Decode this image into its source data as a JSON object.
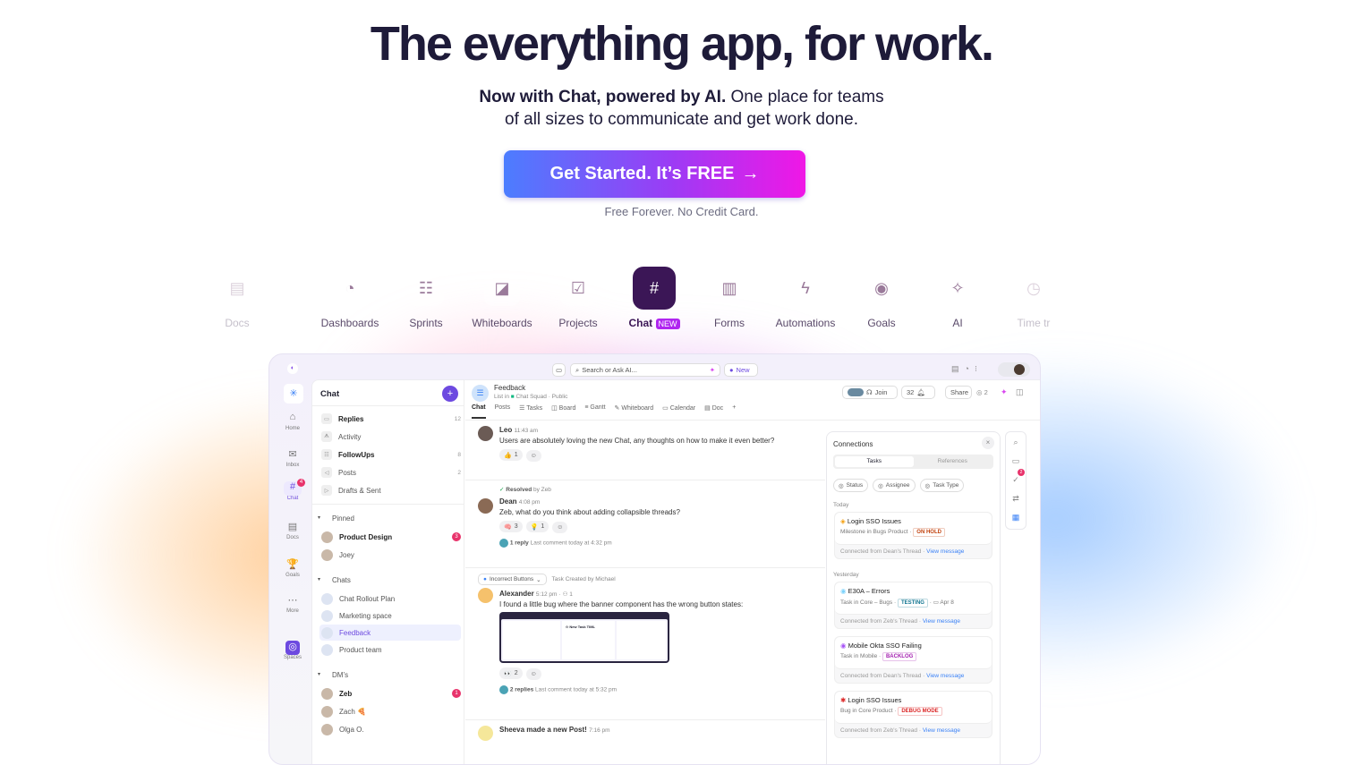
{
  "hero": {
    "title": "The everything app, for work.",
    "subtitle_bold": "Now with Chat, powered by AI.",
    "subtitle_rest": " One place for teams",
    "subtitle_line2": "of all sizes to communicate and get work done.",
    "cta": "Get Started. It’s FREE",
    "cta_arrow": "→",
    "note": "Free Forever. No Credit Card."
  },
  "features": [
    {
      "label": "Docs",
      "icon": "doc-icon"
    },
    {
      "label": "Dashboards",
      "icon": "pie-chart-icon"
    },
    {
      "label": "Sprints",
      "icon": "sprint-icon"
    },
    {
      "label": "Whiteboards",
      "icon": "whiteboard-icon"
    },
    {
      "label": "Projects",
      "icon": "projects-icon"
    },
    {
      "label": "Chat",
      "badge": "NEW",
      "icon": "hash-icon",
      "active": true
    },
    {
      "label": "Forms",
      "icon": "clipboard-icon"
    },
    {
      "label": "Automations",
      "icon": "bolt-icon"
    },
    {
      "label": "Goals",
      "icon": "target-icon"
    },
    {
      "label": "AI",
      "icon": "sparkle-icon"
    },
    {
      "label": "Time tr",
      "icon": "clock-icon"
    }
  ],
  "app": {
    "topbar": {
      "search_placeholder": "Search or Ask AI...",
      "new_label": "New"
    },
    "rail": [
      {
        "label": "Home",
        "icon": "⌂"
      },
      {
        "label": "Inbox",
        "icon": "✉"
      },
      {
        "label": "Chat",
        "icon": "#",
        "badge": "4"
      },
      {
        "label": "Docs",
        "icon": "▤"
      },
      {
        "label": "Goals",
        "icon": "🏆"
      },
      {
        "label": "More",
        "icon": "⋯"
      },
      {
        "label": "Spaces",
        "icon": "◎"
      }
    ],
    "sidebar": {
      "title": "Chat",
      "items": [
        {
          "label": "Replies",
          "count": "12",
          "bold": true
        },
        {
          "label": "Activity"
        },
        {
          "label": "FollowUps",
          "count": "8",
          "bold": true
        },
        {
          "label": "Posts",
          "count": "2"
        },
        {
          "label": "Drafts & Sent"
        }
      ],
      "pinned_label": "Pinned",
      "pinned": [
        {
          "label": "Product Design",
          "badge": "3"
        },
        {
          "label": "Joey"
        }
      ],
      "chats_label": "Chats",
      "chats": [
        {
          "label": "Chat Rollout Plan"
        },
        {
          "label": "Marketing space"
        },
        {
          "label": "Feedback",
          "selected": true
        },
        {
          "label": "Product team"
        }
      ],
      "dms_label": "DM’s",
      "dms": [
        {
          "label": "Zeb",
          "badge": "1"
        },
        {
          "label": "Zach 🍕"
        },
        {
          "label": "Olga O."
        }
      ]
    },
    "channel": {
      "name": "Feedback",
      "list_in": "List in",
      "space": "Chat Squad",
      "visibility": "· Public",
      "join": "Join",
      "count": "32",
      "share": "Share",
      "watchers": "2",
      "tabs": [
        "Chat",
        "Posts",
        "Tasks",
        "Board",
        "Gantt",
        "Whiteboard",
        "Calendar",
        "Doc"
      ]
    },
    "messages": [
      {
        "author": "Leo",
        "time": "11:43 am",
        "text": "Users are absolutely loving the new Chat, any thoughts on how to make it even better?",
        "reactions": [
          {
            "emoji": "👍",
            "count": "1"
          }
        ]
      },
      {
        "resolved": "Resolved",
        "resolved_by": "by Zeb",
        "author": "Dean",
        "time": "4:08 pm",
        "text": "Zeb, what do you think about adding collapsible threads?",
        "reactions": [
          {
            "emoji": "🧠",
            "count": "3"
          },
          {
            "emoji": "💡",
            "count": "1"
          }
        ],
        "replies": "1 reply",
        "last": "Last comment today at 4:32 pm"
      },
      {
        "task": "Incorrect Buttons",
        "task_note": "Task Created by Michael",
        "author": "Alexander",
        "time": "5:12 pm",
        "assignees": "1",
        "text": "I found a little bug where the banner component has the wrong button states:",
        "reactions": [
          {
            "emoji": "👀",
            "count": "2"
          }
        ],
        "replies": "2 replies",
        "last": "Last comment today at 5:32 pm"
      },
      {
        "author": "Sheeva made a new Post!",
        "time": "7:16 pm"
      }
    ],
    "connections": {
      "title": "Connections",
      "tabs": [
        "Tasks",
        "References"
      ],
      "filters": [
        "Status",
        "Assignee",
        "Task Type"
      ],
      "groups": [
        {
          "label": "Today",
          "cards": [
            {
              "title": "Login SSO Issues",
              "meta": "Milestone in Bugs Product",
              "tag": "ON HOLD",
              "tag_color": "#c2410c",
              "from": "Connected from Dean's Thread",
              "link": "View message"
            }
          ]
        },
        {
          "label": "Yesterday",
          "cards": [
            {
              "title": "E30A – Errors",
              "meta": "Task in Core – Bugs",
              "tag": "TESTING",
              "tag_color": "#0e7490",
              "date": "Apr 8",
              "from": "Connected from Zeb's Thread",
              "link": "View message"
            },
            {
              "title": "Mobile Okta SSO Failing",
              "meta": "Task in Mobile",
              "tag": "BACKLOG",
              "tag_color": "#a21caf",
              "from": "Connected from Dean's Thread",
              "link": "View message"
            },
            {
              "title": "Login SSO Issues",
              "meta": "Bug in Core Product",
              "tag": "DEBUG MODE",
              "tag_color": "#dc2626",
              "from": "Connected from Zeb's Thread",
              "link": "View message"
            }
          ]
        }
      ]
    },
    "right_rail_badge": "2"
  }
}
